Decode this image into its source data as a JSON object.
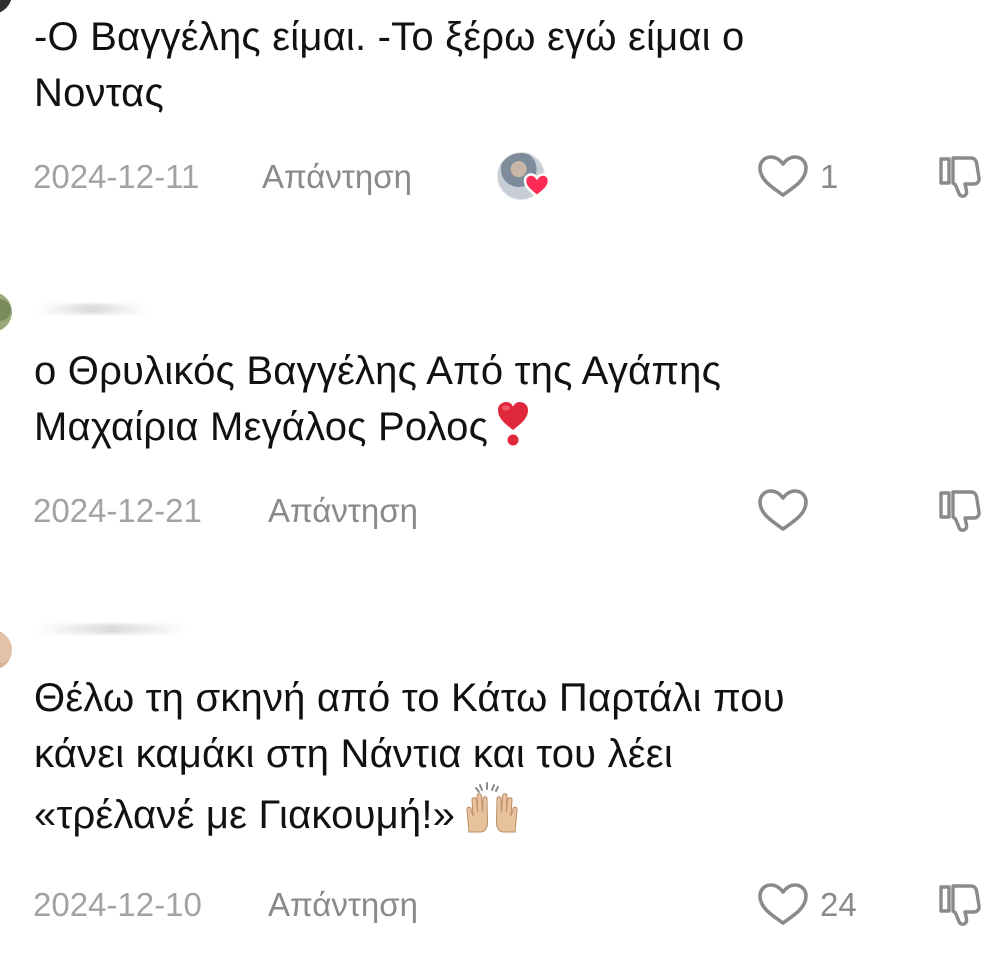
{
  "comments": [
    {
      "text_lines": [
        "-Ο Βαγγέλης είμαι. -Το ξέρω εγώ είμαι ο",
        "Νοντας"
      ],
      "date": "2024-12-11",
      "reply_label": "Απάντηση",
      "creator_liked": true,
      "like_count": "1"
    },
    {
      "text_lines": [
        "ο Θρυλικός Βαγγέλης Από της Αγάπης",
        "Μαχαίρια Μεγάλος Ρολος"
      ],
      "emoji": "heavy-heart-exclamation",
      "date": "2024-12-21",
      "reply_label": "Απάντηση",
      "creator_liked": false,
      "like_count": ""
    },
    {
      "text_lines": [
        "Θέλω τη σκηνή από το Κάτω Παρτάλι που",
        "κάνει καμάκι στη Νάντια και του λέει",
        "«τρέλανέ με Γιακουμή!»"
      ],
      "emoji": "raising-hands",
      "date": "2024-12-10",
      "reply_label": "Απάντηση",
      "creator_liked": false,
      "like_count": "24"
    }
  ],
  "icons": {
    "like": "heart-outline-icon",
    "dislike": "thumbs-down-outline-icon",
    "creator_like": "creator-heart-badge-icon"
  },
  "colors": {
    "text": "#111111",
    "meta": "#a3a3a3",
    "action": "#8a8a8a",
    "heart_badge": "#fe2c55"
  }
}
